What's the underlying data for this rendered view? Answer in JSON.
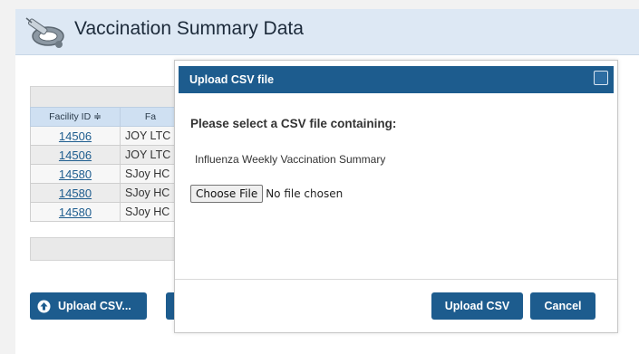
{
  "header": {
    "title": "Vaccination Summary Data",
    "icon": "syringe-stethoscope-icon"
  },
  "grid": {
    "columns": [
      "Facility ID ≑",
      "Fa"
    ],
    "rows": [
      {
        "facility_id": "14506",
        "facility_name": "JOY LTC"
      },
      {
        "facility_id": "14506",
        "facility_name": "JOY LTC"
      },
      {
        "facility_id": "14580",
        "facility_name": "SJoy HC"
      },
      {
        "facility_id": "14580",
        "facility_name": "SJoy HC"
      },
      {
        "facility_id": "14580",
        "facility_name": "SJoy HC"
      }
    ]
  },
  "actions": {
    "upload_csv_label": "Upload CSV...",
    "upload_icon": "up-arrow-circle-icon"
  },
  "dialog": {
    "title": "Upload CSV file",
    "prompt": "Please select a CSV file containing:",
    "summary_type": "Influenza Weekly Vaccination Summary",
    "choose_file_label": "Choose File",
    "file_status": "No file chosen",
    "upload_button": "Upload CSV",
    "cancel_button": "Cancel"
  },
  "colors": {
    "primary": "#1d5c8e",
    "header_bg": "#dde8f4",
    "grid_header_bg": "#cfe0f2",
    "link": "#1d5c8e"
  }
}
